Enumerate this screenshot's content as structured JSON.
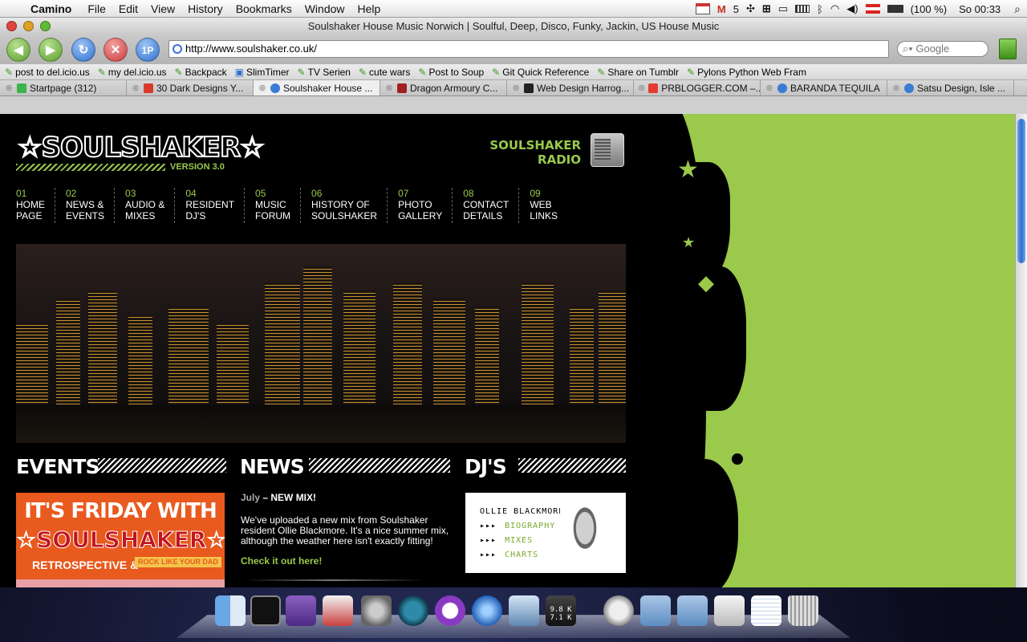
{
  "menubar": {
    "app": "Camino",
    "items": [
      "File",
      "Edit",
      "View",
      "History",
      "Bookmarks",
      "Window",
      "Help"
    ],
    "gmail_count": "5",
    "battery": "(100 %)",
    "clock": "So 00:33"
  },
  "window": {
    "title": "Soulshaker House Music Norwich | Soulful, Deep, Disco, Funky, Jackin, US House Music",
    "url": "http://www.soulshaker.co.uk/",
    "search_placeholder": "Google",
    "nav_back": "◀",
    "nav_fwd": "▶",
    "reload": "↻",
    "stop": "✕",
    "onepassword": "1P"
  },
  "bookmarks": [
    "post to del.icio.us",
    "my del.icio.us",
    "Backpack",
    "SlimTimer",
    "TV Serien",
    "cute wars",
    "Post to Soup",
    "Git Quick Reference",
    "Share on Tumblr",
    "Pylons Python Web Fram"
  ],
  "tabs": [
    {
      "label": "Startpage (312)",
      "favicon": "#3bb54a"
    },
    {
      "label": "30 Dark Designs Y...",
      "favicon": "#d83a2a"
    },
    {
      "label": "Soulshaker House ...",
      "favicon": "#3a7bd5"
    },
    {
      "label": "Dragon Armoury C...",
      "favicon": "#a02020"
    },
    {
      "label": "Web Design Harrog...",
      "favicon": "#222222"
    },
    {
      "label": "PRBLOGGER.COM –...",
      "favicon": "#e53b2f"
    },
    {
      "label": "BARANDA TEQUILA",
      "favicon": "#3a7bd5"
    },
    {
      "label": "Satsu Design, Isle ...",
      "favicon": "#3a7bd5"
    }
  ],
  "site": {
    "logo": "☆SOULSHAKER☆",
    "version": "VERSION 3.0",
    "radio": [
      "SOULSHAKER",
      "RADIO"
    ],
    "nav": [
      {
        "num": "01",
        "l1": "HOME",
        "l2": "PAGE"
      },
      {
        "num": "02",
        "l1": "NEWS &",
        "l2": "EVENTS"
      },
      {
        "num": "03",
        "l1": "AUDIO &",
        "l2": "MIXES"
      },
      {
        "num": "04",
        "l1": "RESIDENT",
        "l2": "DJ'S"
      },
      {
        "num": "05",
        "l1": "MUSIC",
        "l2": "FORUM"
      },
      {
        "num": "06",
        "l1": "HISTORY OF",
        "l2": "SOULSHAKER"
      },
      {
        "num": "07",
        "l1": "PHOTO",
        "l2": "GALLERY"
      },
      {
        "num": "08",
        "l1": "CONTACT",
        "l2": "DETAILS"
      },
      {
        "num": "09",
        "l1": "WEB",
        "l2": "LINKS"
      }
    ],
    "events_heading": "EVENTS",
    "news_heading": "NEWS",
    "djs_heading": "DJ'S",
    "event_banner": {
      "line1": "IT'S FRIDAY WITH",
      "line2": "☆SOULSHAKER☆",
      "line3": "RETROSPECTIVE &",
      "line4": "ROCK LIKE YOUR DAD"
    },
    "news": {
      "month": "July",
      "dash": " – ",
      "title": "NEW MIX!",
      "body": "We've uploaded a new mix from Soulshaker resident Ollie Blackmore. It's a nice summer mix, although the weather here isn't exactly fitting!",
      "link": "Check it out here!"
    },
    "dj": {
      "name": "OLLIE BLACKMORE",
      "links": [
        "BIOGRAPHY",
        "MIXES",
        "CHARTS"
      ],
      "arrow": "▸▸▸"
    }
  },
  "dock": {
    "stats_up": "9.8 K",
    "stats_down": "7.1 K"
  },
  "colors": {
    "accent_green": "#9ac94b",
    "event_orange": "#e85a1e",
    "menubar": "#e8e8e8"
  }
}
